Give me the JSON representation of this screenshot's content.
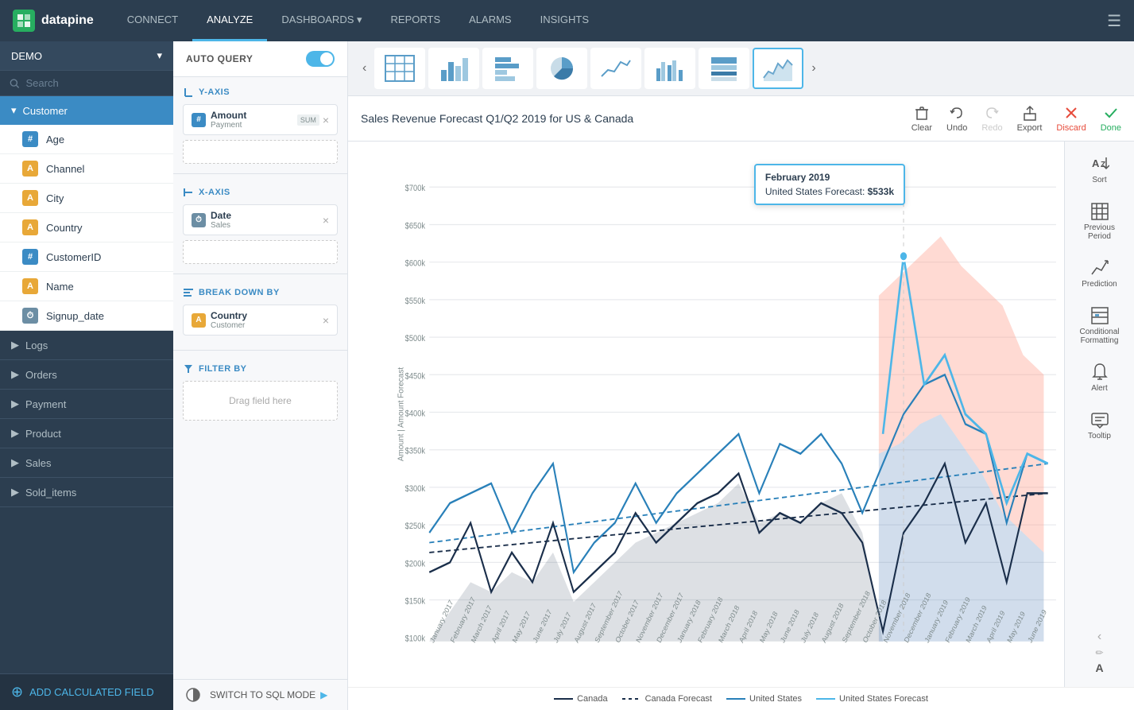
{
  "app": {
    "logo_text": "datapine",
    "logo_abbr": "d"
  },
  "nav": {
    "items": [
      {
        "label": "CONNECT",
        "active": false
      },
      {
        "label": "ANALYZE",
        "active": true
      },
      {
        "label": "DASHBOARDS ▾",
        "active": false
      },
      {
        "label": "REPORTS",
        "active": false
      },
      {
        "label": "ALARMS",
        "active": false
      },
      {
        "label": "INSIGHTS",
        "active": false
      }
    ]
  },
  "sidebar": {
    "demo_label": "DEMO",
    "search_placeholder": "Search",
    "groups": [
      {
        "name": "Customer",
        "expanded": true,
        "fields": [
          {
            "label": "Age",
            "type": "hash"
          },
          {
            "label": "Channel",
            "type": "text"
          },
          {
            "label": "City",
            "type": "text"
          },
          {
            "label": "Country",
            "type": "text"
          },
          {
            "label": "CustomerID",
            "type": "hash"
          },
          {
            "label": "Name",
            "type": "text"
          },
          {
            "label": "Signup_date",
            "type": "clock"
          }
        ]
      },
      {
        "name": "Logs",
        "expanded": false,
        "fields": []
      },
      {
        "name": "Orders",
        "expanded": false,
        "fields": []
      },
      {
        "name": "Payment",
        "expanded": false,
        "fields": []
      },
      {
        "name": "Product",
        "expanded": false,
        "fields": []
      },
      {
        "name": "Sales",
        "expanded": false,
        "fields": []
      },
      {
        "name": "Sold_items",
        "expanded": false,
        "fields": []
      }
    ],
    "add_calc_label": "ADD CALCULATED FIELD"
  },
  "query_panel": {
    "auto_query_label": "AUTO QUERY",
    "y_axis_label": "Y-AXIS",
    "x_axis_label": "X-AXIS",
    "break_down_label": "BREAK DOWN BY",
    "filter_by_label": "FILTER BY",
    "drag_placeholder": "Drag field here",
    "y_axis_field": {
      "name": "Amount",
      "sub": "Payment",
      "tag": "SUM"
    },
    "x_axis_field": {
      "name": "Date",
      "sub": "Sales"
    },
    "breakdown_field": {
      "name": "Country",
      "sub": "Customer"
    }
  },
  "chart": {
    "title": "Sales Revenue Forecast Q1/Q2 2019 for US & Canada",
    "y_axis_label": "Amount | Amount Forecast",
    "tooltip": {
      "date": "February 2019",
      "label": "United States Forecast:",
      "value": "$533k"
    },
    "x_labels": [
      "January 2017",
      "February 2017",
      "March 2017",
      "April 2017",
      "May 2017",
      "June 2017",
      "July 2017",
      "August 2017",
      "September 2017",
      "October 2017",
      "November 2017",
      "December 2017",
      "January 2018",
      "February 2018",
      "March 2018",
      "April 2018",
      "May 2018",
      "June 2018",
      "July 2018",
      "August 2018",
      "September 2018",
      "October 2018",
      "November 2018",
      "December 2018",
      "January 2019",
      "February 2019",
      "March 2019",
      "April 2019",
      "May 2019",
      "June 2019"
    ],
    "y_ticks": [
      "$100k",
      "$150k",
      "$200k",
      "$250k",
      "$300k",
      "$350k",
      "$400k",
      "$450k",
      "$500k",
      "$550k",
      "$600k",
      "$650k",
      "$700k"
    ],
    "legend": [
      {
        "label": "Canada",
        "color": "#1a2e4a",
        "dashed": false
      },
      {
        "label": "Canada Forecast",
        "color": "#1a2e4a",
        "dashed": true
      },
      {
        "label": "United States",
        "color": "#2980b9",
        "dashed": false
      },
      {
        "label": "United States Forecast",
        "color": "#4db6e8",
        "dashed": false
      }
    ]
  },
  "toolbar": {
    "clear_label": "Clear",
    "undo_label": "Undo",
    "redo_label": "Redo",
    "export_label": "Export",
    "discard_label": "Discard",
    "done_label": "Done"
  },
  "right_panel": {
    "buttons": [
      {
        "label": "Sort",
        "icon": "az"
      },
      {
        "label": "Previous Period",
        "icon": "grid"
      },
      {
        "label": "Prediction",
        "icon": "prediction"
      },
      {
        "label": "Conditional Formatting",
        "icon": "conditional"
      },
      {
        "label": "Alert",
        "icon": "bell"
      },
      {
        "label": "Tooltip",
        "icon": "tooltip"
      }
    ]
  },
  "bottom_bar": {
    "switch_label": "SWITCH TO SQL MODE"
  }
}
